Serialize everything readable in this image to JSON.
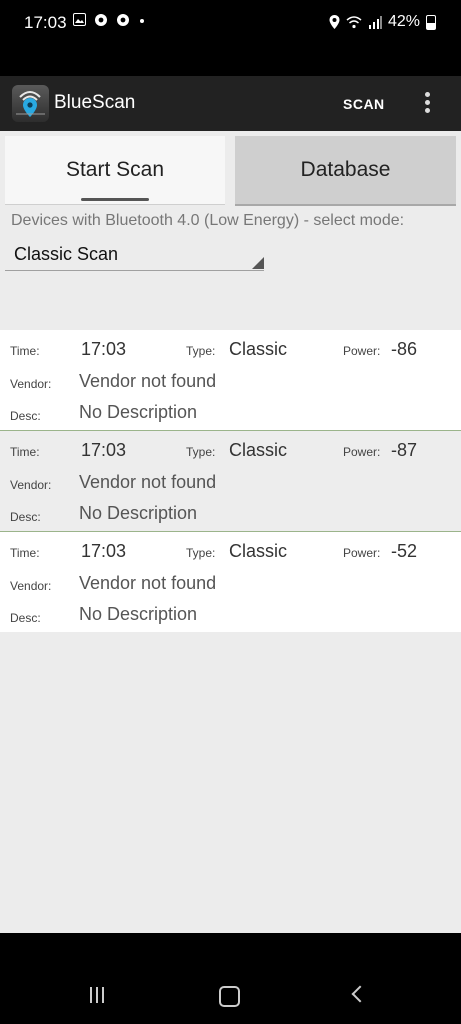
{
  "status_bar": {
    "time": "17:03",
    "battery_text": "42%",
    "notification_icons": [
      "image-icon",
      "chrome-icon",
      "chrome-icon",
      "dot-icon"
    ],
    "system_icons": [
      "location-icon",
      "wifi-icon",
      "signal-icon",
      "battery-icon"
    ]
  },
  "app_bar": {
    "title": "BlueScan",
    "action_label": "SCAN",
    "overflow_icon": "more-vert-icon"
  },
  "tabs": [
    {
      "label": "Start Scan",
      "selected": true
    },
    {
      "label": "Database",
      "selected": false
    }
  ],
  "description": "Devices with Bluetooth 4.0 (Low Energy) - select mode:",
  "mode_select": {
    "selected": "Classic Scan"
  },
  "field_labels": {
    "time": "Time:",
    "type": "Type:",
    "power": "Power:",
    "vendor": "Vendor:",
    "desc": "Desc:"
  },
  "devices": [
    {
      "time": "17:03",
      "type": "Classic",
      "power": "-86",
      "vendor": "Vendor not found",
      "desc": "No Description"
    },
    {
      "time": "17:03",
      "type": "Classic",
      "power": "-87",
      "vendor": "Vendor not found",
      "desc": "No Description"
    },
    {
      "time": "17:03",
      "type": "Classic",
      "power": "-52",
      "vendor": "Vendor not found",
      "desc": "No Description"
    }
  ],
  "nav_bar": {
    "buttons": [
      "recent-apps-icon",
      "home-icon",
      "back-icon"
    ]
  },
  "colors": {
    "app_bar": "#222222",
    "background": "#ececec",
    "row_separator": "#9bb48b",
    "accent_logo": "#29a9e1"
  }
}
